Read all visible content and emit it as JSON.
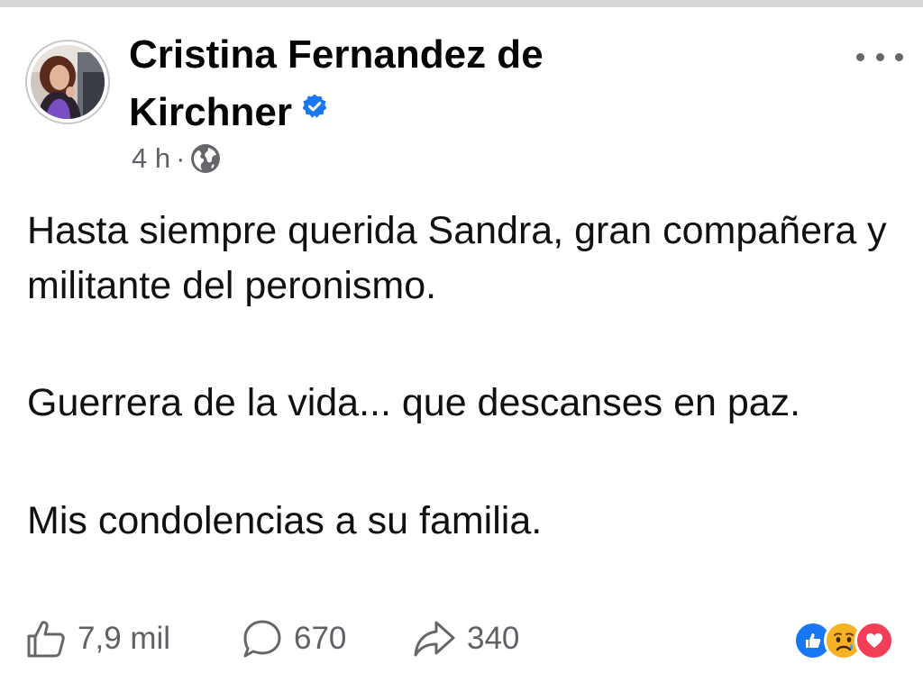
{
  "post": {
    "author": "Cristina Fernandez de Kirchner",
    "time": "4 h",
    "separator": "·",
    "audience_icon": "globe-icon",
    "verified_icon": "verified-badge-icon",
    "paragraphs": [
      "Hasta siempre querida Sandra, gran compañera y militante del peronismo.",
      "Guerrera de la vida... que descanses en paz.",
      "Mis condolencias a su familia."
    ]
  },
  "actions": {
    "like_count": "7,9 mil",
    "comment_count": "670",
    "share_count": "340"
  },
  "reactions": [
    "like-reaction-icon",
    "sad-reaction-icon",
    "love-reaction-icon"
  ],
  "colors": {
    "verified_blue": "#1877f2",
    "like_blue": "#1877f2",
    "love_red": "#f33e58",
    "sad_yellow": "#f7b125",
    "meta_gray": "#65676b",
    "divider": "#d8d8da"
  }
}
